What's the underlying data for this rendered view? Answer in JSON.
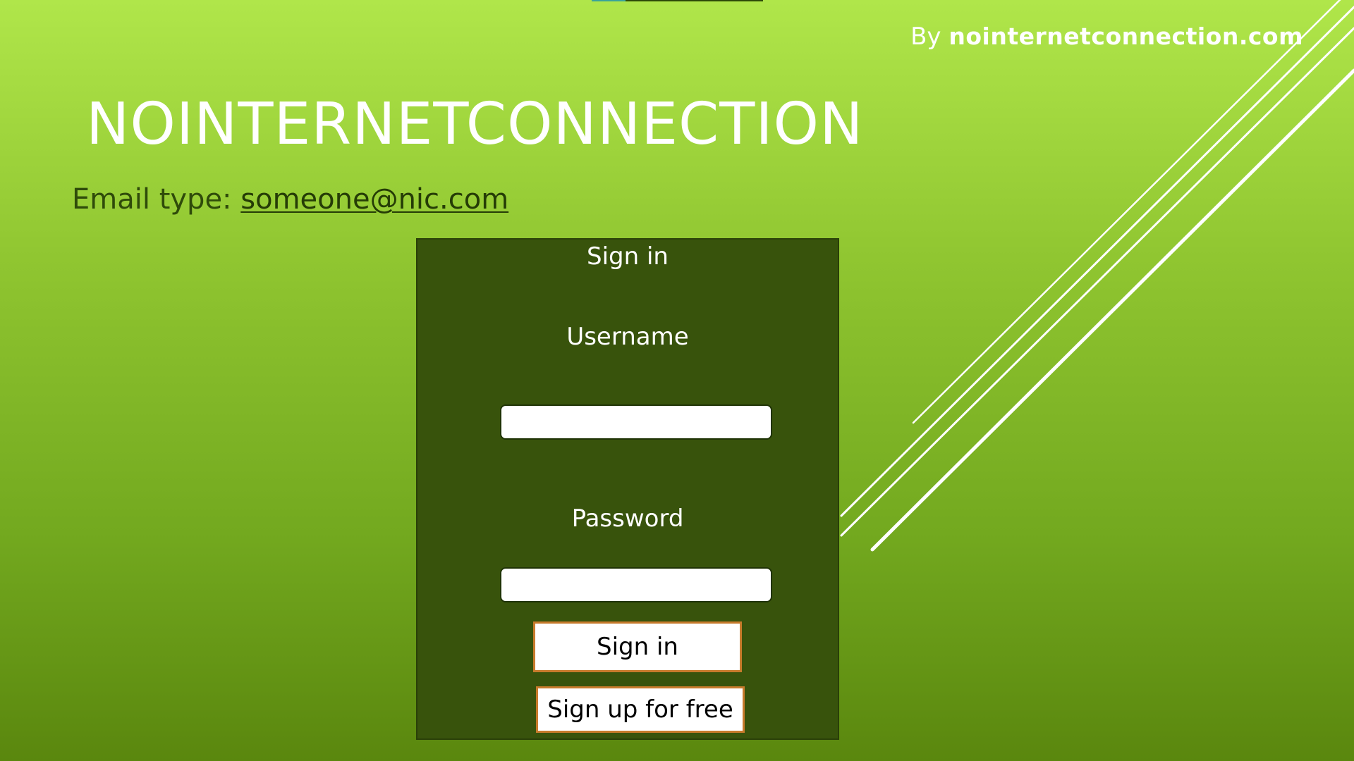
{
  "header": {
    "byline_prefix": "By",
    "byline_brand": "nointernetconnection.com"
  },
  "main": {
    "title": "NOINTERNETCONNECTION",
    "email_prefix": "Email type:",
    "email_example": "someone@nic.com"
  },
  "login": {
    "title": "Sign in",
    "username_label": "Username",
    "username_value": "",
    "password_label": "Password",
    "password_value": "",
    "signin_button": "Sign in",
    "signup_button": "Sign up for free"
  },
  "colors": {
    "background_top": "#b0e64a",
    "background_bottom": "#5a870e",
    "panel": "#38530c",
    "button_border": "#c77b2c",
    "text_light": "#ffffff",
    "text_dark": "#2f4b0a"
  }
}
